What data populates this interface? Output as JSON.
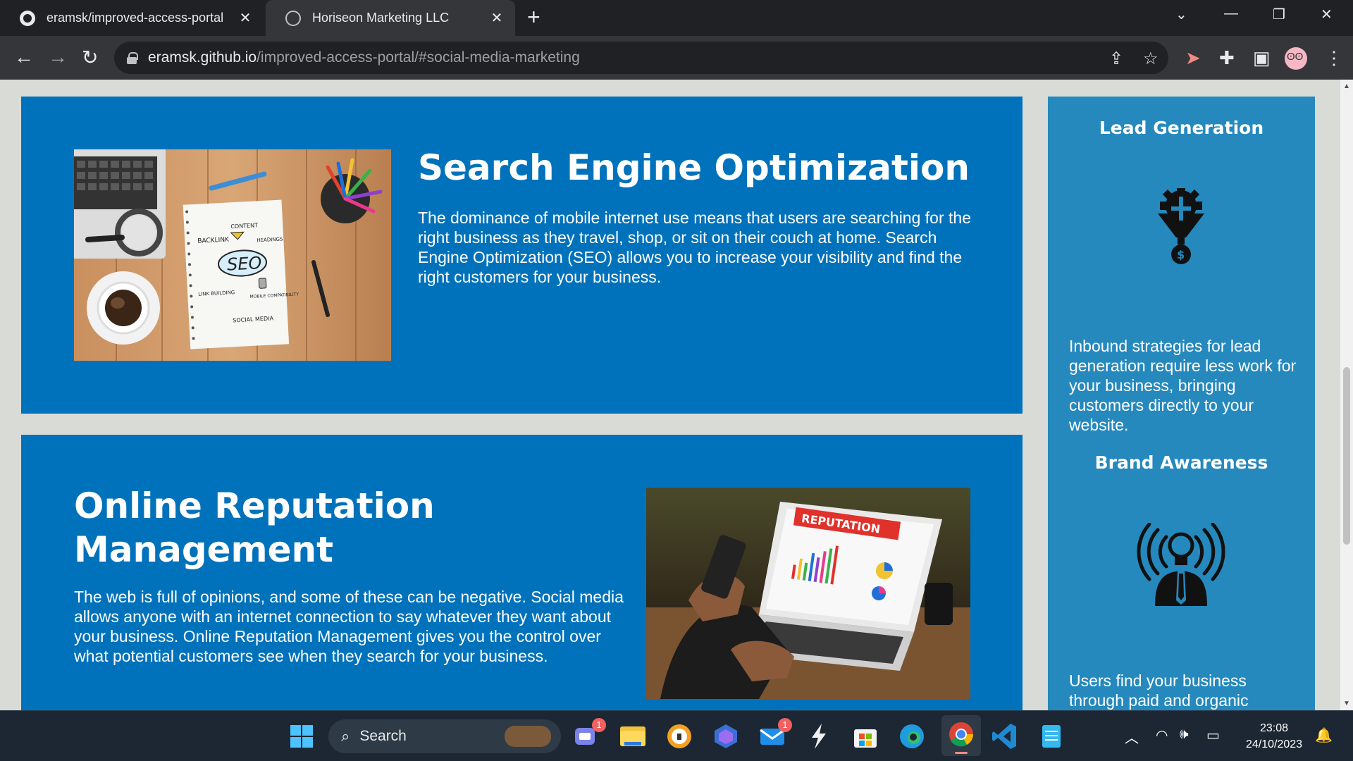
{
  "browser": {
    "tabs": [
      {
        "title": "eramsk/improved-access-portal",
        "favicon": "github-icon",
        "active": false
      },
      {
        "title": "Horiseon Marketing LLC",
        "favicon": "globe-icon",
        "active": true
      }
    ],
    "address": {
      "host": "eramsk.github.io",
      "path": "/improved-access-portal/#social-media-marketing"
    }
  },
  "page": {
    "seo": {
      "heading": "Search Engine Optimization",
      "body": "The dominance of mobile internet use means that users are searching for the right business as they travel, shop, or sit on their couch at home. Search Engine Optimization (SEO) allows you to increase your visibility and find the right customers for your business.",
      "image_words": [
        "CONTENT",
        "BACKLINK",
        "HEADINGS",
        "SEO",
        "LINK BUILDING",
        "MOBILE COMPATIBILITY",
        "SOCIAL MEDIA"
      ]
    },
    "orm": {
      "heading_line1": "Online Reputation",
      "heading_line2": "Management",
      "body": "The web is full of opinions, and some of these can be negative. Social media allows anyone with an internet connection to say whatever they want about your business. Online Reputation Management gives you the control over what potential customers see when they search for your business.",
      "image_word": "REPUTATION"
    },
    "benefits": {
      "lead": {
        "heading": "Lead Generation",
        "body": "Inbound strategies for lead generation require less work for your business, bringing customers directly to your website.",
        "icon": "lead-generation-icon"
      },
      "brand": {
        "heading": "Brand Awareness",
        "body": "Users find your business through paid and organic searches, increasing the search",
        "icon": "brand-awareness-icon"
      }
    }
  },
  "taskbar": {
    "search_placeholder": "Search",
    "teams_badge": "1",
    "mail_badge": "1",
    "time": "23:08",
    "date": "24/10/2023"
  },
  "colors": {
    "section_blue": "#0072bb",
    "aside_blue": "#2589bd",
    "page_bg": "#d9dbd7"
  }
}
